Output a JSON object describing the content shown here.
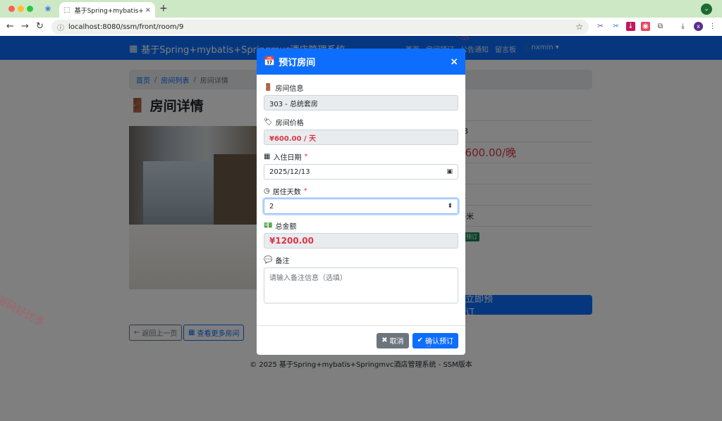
{
  "browser": {
    "tab_title": "基于Spring+mybatis+Springmvc",
    "tab_close": "×",
    "new_tab": "+",
    "url": "localhost:8080/ssm/front/room/9",
    "profile_initial": "x"
  },
  "site": {
    "brand": "基于Spring+mybatis+Springmvc酒店管理系统",
    "nav": [
      "首页",
      "房间预订",
      "公告通知",
      "留言板"
    ],
    "user": "nxmin"
  },
  "breadcrumb": {
    "home": "首页",
    "list": "房间列表",
    "current": "房间详情"
  },
  "page_title": "房间详情",
  "details": {
    "room_number_partial": "03",
    "price_partial": "¥600.00/晚",
    "capacity_partial": "人",
    "bed_partial": "张",
    "area_partial": "平米",
    "status_badge": "可预订"
  },
  "book_now": "立即预订",
  "back_button": "返回上一页",
  "more_button": "查看更多房间",
  "footer": "© 2025 基于Spring+mybatis+Springmvc酒店管理系统 - SSM版本",
  "watermark": "源码好优多",
  "modal": {
    "title": "预订房间",
    "close": "×",
    "room_info_label": "房间信息",
    "room_info_value": "303 - 总统套房",
    "price_label": "房间价格",
    "price_value": "¥600.00 / 天",
    "checkin_label": "入住日期",
    "checkin_value": "2025/12/13",
    "days_label": "居住天数",
    "days_value": "2",
    "total_label": "总金额",
    "total_value": "¥1200.00",
    "remark_label": "备注",
    "remark_placeholder": "请输入备注信息（选填）",
    "required_mark": "*",
    "cancel": "取消",
    "confirm": "确认预订"
  },
  "colors": {
    "primary": "#0d6efd",
    "danger": "#dc3545",
    "secondary": "#6c757d",
    "success": "#198754"
  }
}
